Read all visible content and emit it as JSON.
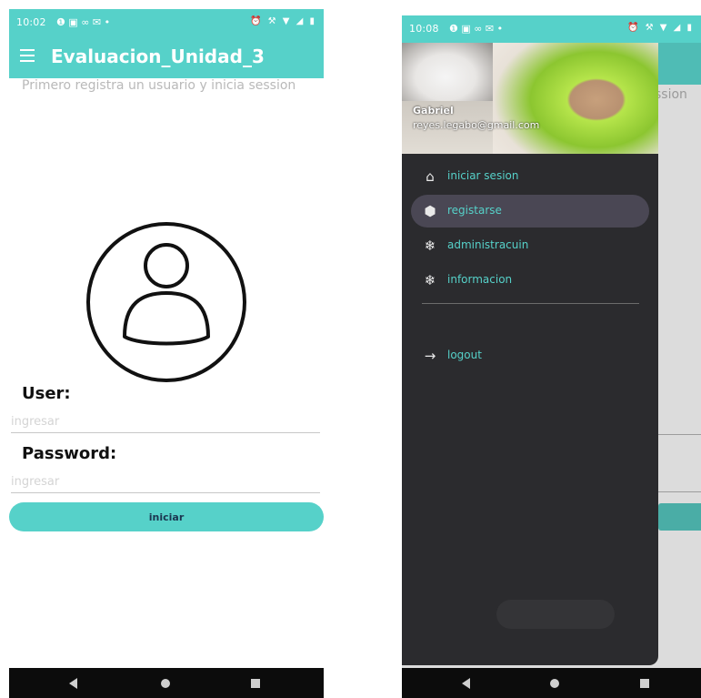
{
  "left": {
    "status": {
      "time": "10:02",
      "icons_left": "❶ ▣ ∞ ✉ •",
      "icons_right": "⏰ ⚒ ▼ ◢ ▮"
    },
    "appbar": {
      "title": "Evaluacion_Unidad_3"
    },
    "subtitle": "Primero registra un usuario y inicia session",
    "form": {
      "user_label": "User:",
      "user_placeholder": "ingresar",
      "password_label": "Password:",
      "password_placeholder": "ingresar",
      "login_button": "iniciar"
    }
  },
  "right": {
    "status": {
      "time": "10:08",
      "icons_left": "❶ ▣ ∞ ✉ •",
      "icons_right": "⏰ ⚒ ▼ ◢ ▮"
    },
    "background": {
      "subtitle_fragment": "ssion"
    },
    "drawer": {
      "user_name": "Gabriel",
      "user_email": "reyes.legabo@gmail.com",
      "items": [
        {
          "label": "iniciar sesion",
          "icon": "home-icon",
          "glyph": "⌂",
          "active": false
        },
        {
          "label": "registarse",
          "icon": "hexagon-icon",
          "glyph": "⬢",
          "active": true
        },
        {
          "label": "administracuin",
          "icon": "snowflake-icon",
          "glyph": "❄",
          "active": false
        },
        {
          "label": "informacion",
          "icon": "snowflake-icon",
          "glyph": "❄",
          "active": false
        }
      ],
      "logout": {
        "label": "logout",
        "icon": "arrow-right-icon",
        "glyph": "→"
      }
    }
  },
  "colors": {
    "accent": "#56d1c9",
    "drawer_bg": "#2b2b2e",
    "drawer_active": "#4a4754",
    "button_text": "#1b3550"
  }
}
